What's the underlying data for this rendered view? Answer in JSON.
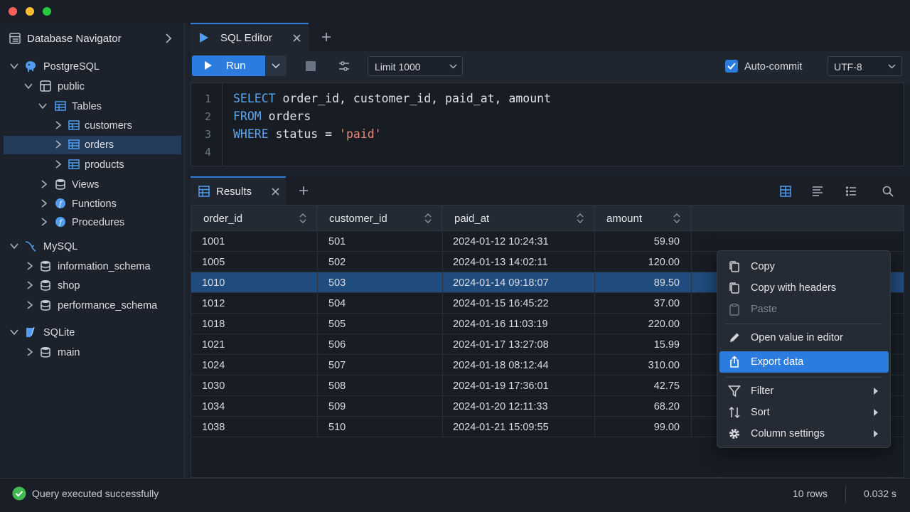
{
  "sidebar": {
    "title": "Database Navigator",
    "tree": [
      {
        "label": "PostgreSQL",
        "type": "server-postgres"
      },
      {
        "label": "public",
        "type": "schema"
      },
      {
        "label": "Tables",
        "type": "folder-tables"
      },
      {
        "label": "customers",
        "type": "table"
      },
      {
        "label": "orders",
        "type": "table",
        "selected": true
      },
      {
        "label": "products",
        "type": "table"
      },
      {
        "label": "Views",
        "type": "folder"
      },
      {
        "label": "Functions",
        "type": "folder-func"
      },
      {
        "label": "Procedures",
        "type": "folder-func"
      },
      {
        "label": "MySQL",
        "type": "server-mysql"
      },
      {
        "label": "information_schema",
        "type": "db"
      },
      {
        "label": "shop",
        "type": "db"
      },
      {
        "label": "performance_schema",
        "type": "db"
      },
      {
        "label": "SQLite",
        "type": "server-sqlite"
      },
      {
        "label": "main",
        "type": "db"
      }
    ]
  },
  "editor": {
    "tab_label": "SQL Editor",
    "run_label": "Run",
    "limit_value": "Limit 1000",
    "autocommit_label": "Auto-commit",
    "autocommit_checked": true,
    "encoding_value": "UTF-8",
    "line_numbers": [
      "1",
      "2",
      "3",
      "4"
    ],
    "code": {
      "l1_kw": "SELECT",
      "l1_rest": " order_id, customer_id, paid_at, amount",
      "l2_kw": "FROM",
      "l2_rest": " orders",
      "l3_kw": "WHERE",
      "l3_rest": " status = ",
      "l3_str": "'paid'"
    }
  },
  "results": {
    "tab_label": "Results",
    "columns": [
      "order_id",
      "customer_id",
      "paid_at",
      "amount"
    ],
    "rows": [
      [
        "1001",
        "501",
        "2024-01-12 10:24:31",
        "59.90"
      ],
      [
        "1005",
        "502",
        "2024-01-13 14:02:11",
        "120.00"
      ],
      [
        "1010",
        "503",
        "2024-01-14 09:18:07",
        "89.50"
      ],
      [
        "1012",
        "504",
        "2024-01-15 16:45:22",
        "37.00"
      ],
      [
        "1018",
        "505",
        "2024-01-16 11:03:19",
        "220.00"
      ],
      [
        "1021",
        "506",
        "2024-01-17 13:27:08",
        "15.99"
      ],
      [
        "1024",
        "507",
        "2024-01-18 08:12:44",
        "310.00"
      ],
      [
        "1030",
        "508",
        "2024-01-19 17:36:01",
        "42.75"
      ],
      [
        "1034",
        "509",
        "2024-01-20 12:11:33",
        "68.20"
      ],
      [
        "1038",
        "510",
        "2024-01-21 15:09:55",
        "99.00"
      ]
    ],
    "selected_row_index": 2
  },
  "context_menu": {
    "copy": "Copy",
    "copy_headers": "Copy with headers",
    "paste": "Paste",
    "open_value": "Open value in editor",
    "export": "Export data",
    "filter": "Filter",
    "sort": "Sort",
    "column_settings": "Column settings"
  },
  "status": {
    "message": "Query executed successfully",
    "rows": "10 rows",
    "time": "0.032 s"
  },
  "colors": {
    "accent": "#2f7fd8",
    "selection": "#1f4b7d",
    "success": "#3fb950"
  }
}
